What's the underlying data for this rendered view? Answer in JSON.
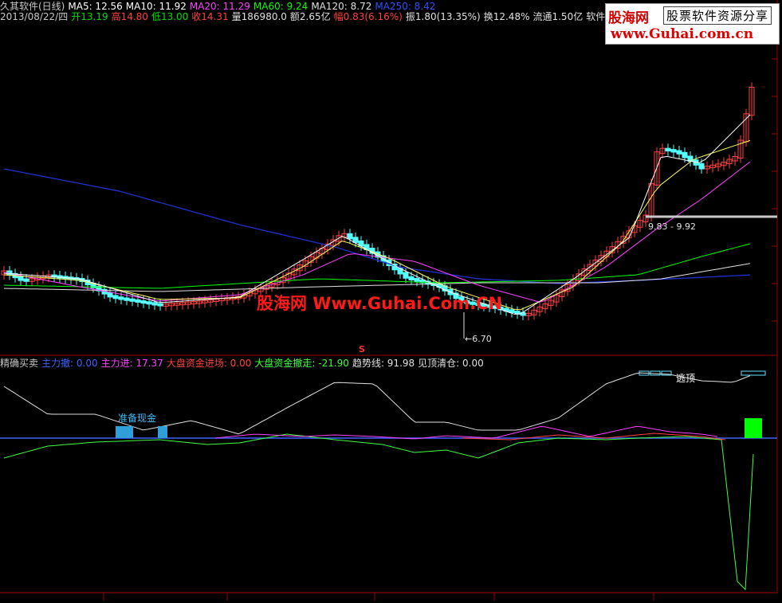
{
  "header": {
    "line1": [
      {
        "text": "久其软件(日线)",
        "color": "#c8c8c8"
      },
      {
        "text": "MA5: 12.56",
        "color": "#ffffff"
      },
      {
        "text": "MA10: 11.92",
        "color": "#ffffff"
      },
      {
        "text": "MA20: 11.29",
        "color": "#ff40ff"
      },
      {
        "text": "MA60: 9.24",
        "color": "#00ff00"
      },
      {
        "text": "MA120: 8.72",
        "color": "#e0e0e0"
      },
      {
        "text": "MA250: 8.42",
        "color": "#3050ff"
      }
    ],
    "line2": [
      {
        "text": "2013/08/22/四",
        "color": "#c8c8c8"
      },
      {
        "text": "开13.19",
        "color": "#00e000"
      },
      {
        "text": "高14.80",
        "color": "#ff4040"
      },
      {
        "text": "低13.00",
        "color": "#00e000"
      },
      {
        "text": "收14.31",
        "color": "#ff4040"
      },
      {
        "text": "量186980.0",
        "color": "#e0e0e0"
      },
      {
        "text": "额2.65亿",
        "color": "#e0e0e0"
      },
      {
        "text": "幅0.83(6.16%)",
        "color": "#ff4040"
      },
      {
        "text": "振1.80(13.35%)",
        "color": "#e0e0e0"
      },
      {
        "text": "换12.48%",
        "color": "#e0e0e0"
      },
      {
        "text": "流通1.50亿",
        "color": "#e0e0e0"
      },
      {
        "text": "软件服务",
        "color": "#e0e0e0"
      }
    ]
  },
  "indicator": {
    "line": [
      {
        "text": "精确买卖",
        "color": "#c8c8c8"
      },
      {
        "text": "主力撤: 0.00",
        "color": "#4060ff"
      },
      {
        "text": "主力进: 17.37",
        "color": "#ff40ff"
      },
      {
        "text": "大盘资金进场: 0.00",
        "color": "#ff4040"
      },
      {
        "text": "大盘资金撤走: -21.90",
        "color": "#40ff40"
      },
      {
        "text": "趋势线: 91.98",
        "color": "#e0e0e0"
      },
      {
        "text": "见顶清仓: 0.00",
        "color": "#e0e0e0"
      }
    ],
    "prepare_label": "准备现金",
    "escape_label": "逃顶"
  },
  "annotations": {
    "low_marker": "←6.70",
    "range_marker": "9.83 - 9.92",
    "s_marker": "S"
  },
  "watermark": "股海网 Www.Guhai.Com.CN",
  "logo": {
    "name": "股海网",
    "slogan": "股票软件资源分享",
    "url": "www.Guhai.com.cn"
  },
  "colors": {
    "up": "#ff4040",
    "down": "#54ffff",
    "ma5": "#ffffff",
    "ma10": "#ffff60",
    "ma20": "#ff40ff",
    "ma60": "#00ff00",
    "ma120": "#e0e0e0",
    "ma250": "#2030d0",
    "trend": "#e0e0e0",
    "retail": "#40ff40",
    "main_in": "#ff40ff",
    "main_out": "#4060ff",
    "market_in": "#ff4040"
  }
}
